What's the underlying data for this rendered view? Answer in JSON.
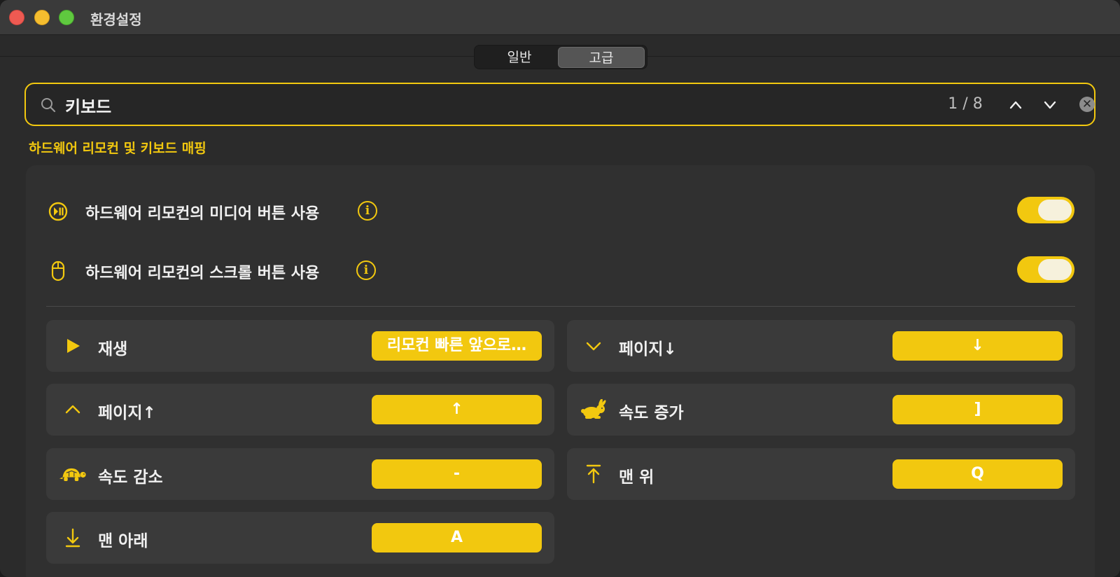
{
  "window": {
    "title": "환경설정"
  },
  "tabs": [
    {
      "label": "일반"
    },
    {
      "label": "고급"
    }
  ],
  "search": {
    "value": "키보드",
    "match_count": "1 / 8"
  },
  "section": {
    "title": "하드웨어 리모컨 및 키보드 매핑"
  },
  "toggles": [
    {
      "label": "하드웨어 리모컨의 미디어 버튼 사용",
      "icon": "play-pause-circle-icon",
      "on": true
    },
    {
      "label": "하드웨어 리모컨의 스크롤 버튼 사용",
      "icon": "mouse-icon",
      "on": true
    }
  ],
  "shortcuts": [
    {
      "label": "재생",
      "key": "리모컨 빠른 앞으로…",
      "icon": "play-icon"
    },
    {
      "label": "페이지↓",
      "key": "↓",
      "icon": "chevron-down-icon"
    },
    {
      "label": "페이지↑",
      "key": "↑",
      "icon": "chevron-up-icon"
    },
    {
      "label": "속도 증가",
      "key": "]",
      "icon": "rabbit-icon"
    },
    {
      "label": "속도 감소",
      "key": "-",
      "icon": "turtle-icon"
    },
    {
      "label": "맨 위",
      "key": "Q",
      "icon": "arrow-to-top-icon"
    },
    {
      "label": "맨 아래",
      "key": "A",
      "icon": "arrow-down-icon"
    }
  ],
  "colors": {
    "accent": "#f2c80f",
    "background": "#2b2b2b",
    "panel": "#303030",
    "cell": "#3a3a3a"
  }
}
